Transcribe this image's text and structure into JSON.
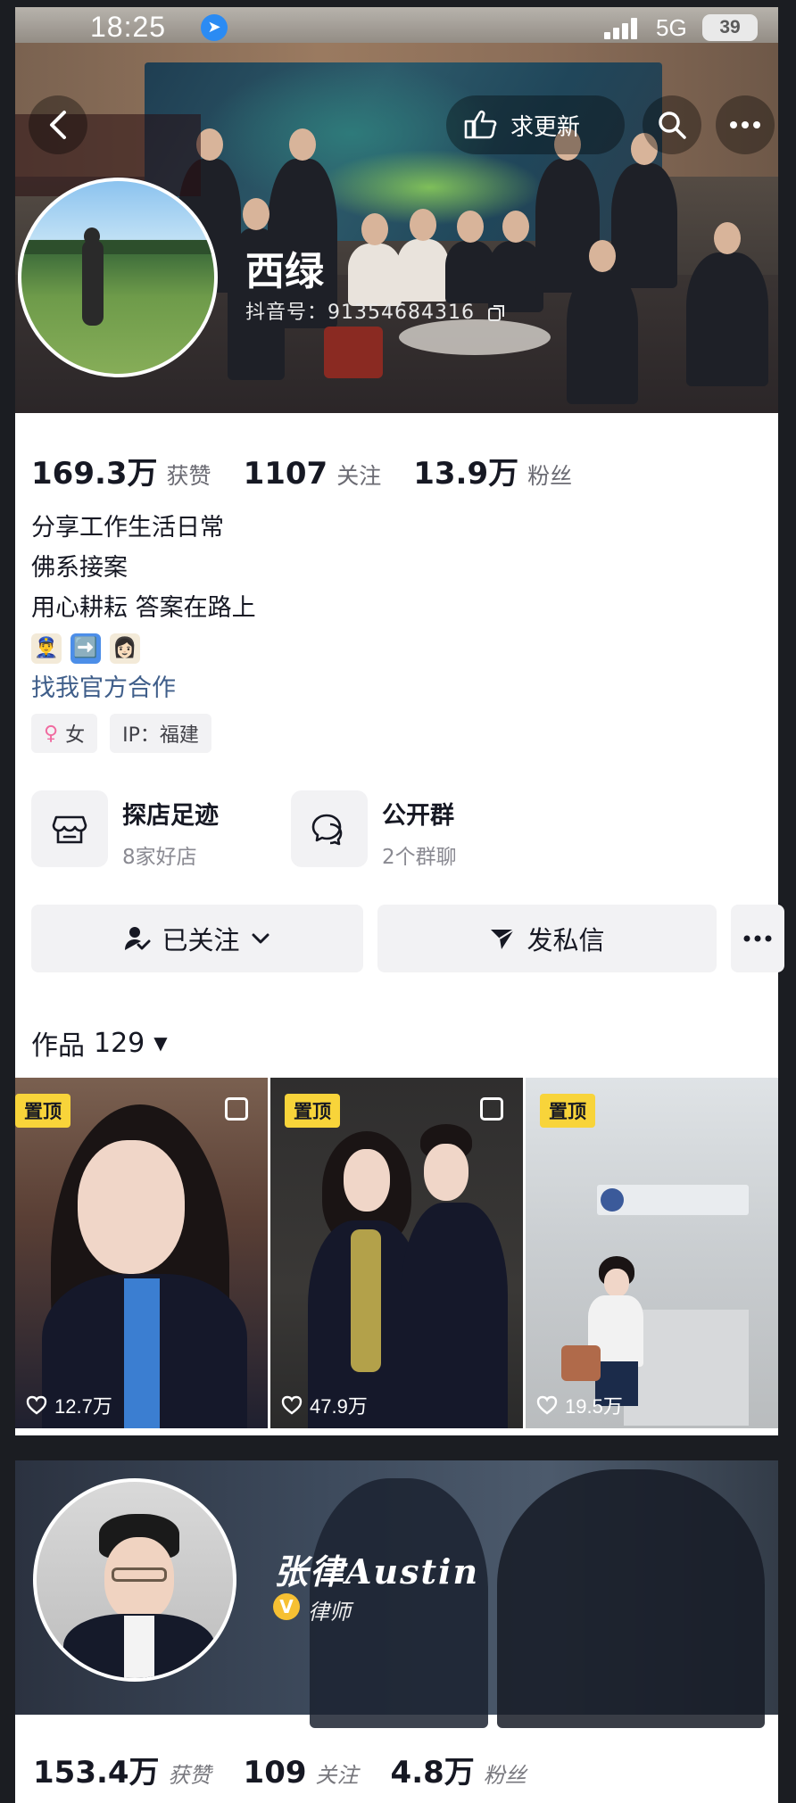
{
  "status_bar": {
    "time": "18:25",
    "network": "5G",
    "battery": "39"
  },
  "profile": {
    "update_button": "求更新",
    "name": "西绿",
    "douyin_id": "抖音号：91354684316",
    "stats": [
      {
        "value": "169.3万",
        "label": "获赞"
      },
      {
        "value": "1107",
        "label": "关注"
      },
      {
        "value": "13.9万",
        "label": "粉丝"
      }
    ],
    "bio": [
      "分享工作生活日常",
      "佛系接案",
      "用心耕耘 答案在路上"
    ],
    "bio_emojis": [
      "👮‍♂️",
      "➡️",
      "👩🏻"
    ],
    "cooperation_link": "找我官方合作",
    "tags": {
      "gender": "女",
      "ip": "IP：福建"
    },
    "features": [
      {
        "title": "探店足迹",
        "subtitle": "8家好店",
        "icon": "storefront-icon"
      },
      {
        "title": "公开群",
        "subtitle": "2个群聊",
        "icon": "group-chat-icon"
      }
    ],
    "actions": {
      "follow": "已关注",
      "message": "发私信"
    },
    "works": {
      "label": "作品",
      "count": "129"
    },
    "videos": [
      {
        "badge": "置顶",
        "likes": "12.7万"
      },
      {
        "badge": "置顶",
        "likes": "47.9万"
      },
      {
        "badge": "置顶",
        "likes": "19.5万"
      }
    ]
  },
  "second_profile": {
    "name": "张律Austin",
    "title": "律师",
    "stats": [
      {
        "value": "153.4万",
        "label": "获赞"
      },
      {
        "value": "109",
        "label": "关注"
      },
      {
        "value": "4.8万",
        "label": "粉丝"
      }
    ]
  },
  "colors": {
    "accent_link": "#3f5e8a",
    "pin_badge": "#f8d43a",
    "verify": "#f6c033",
    "location": "#2b8bf3"
  }
}
